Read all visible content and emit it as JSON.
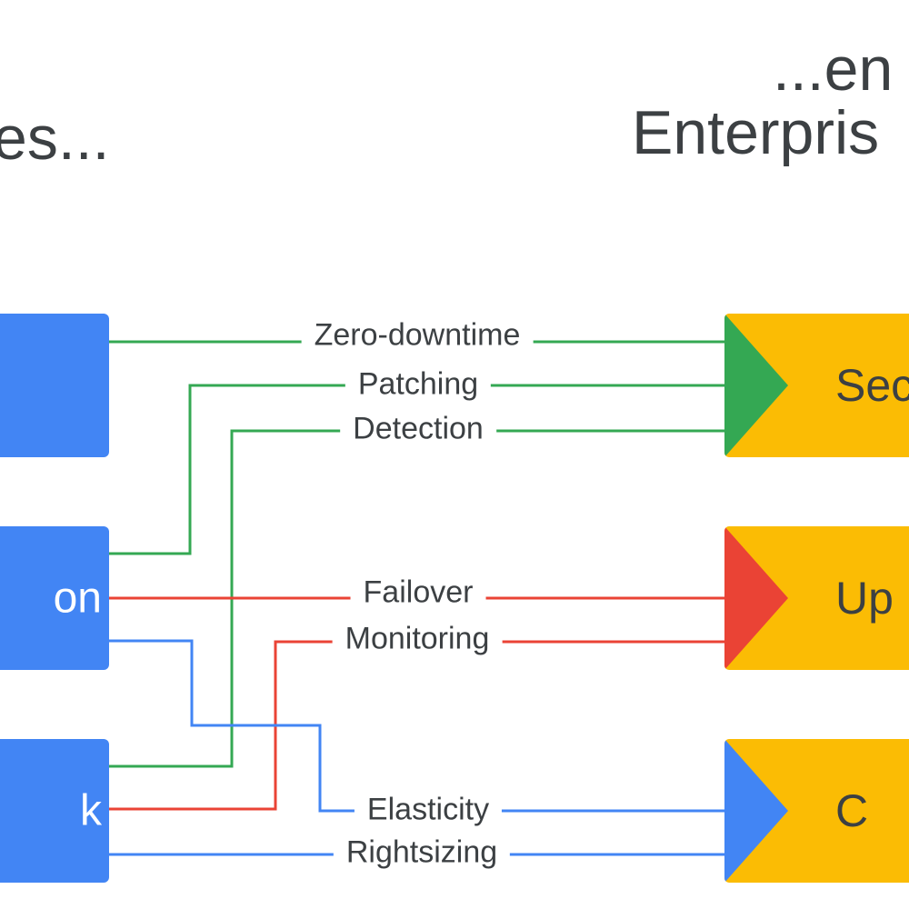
{
  "heading_left": "es...",
  "heading_right_line1": "...en",
  "heading_right_line2": "Enterpris",
  "colors": {
    "blue": "#4285f4",
    "green": "#34a853",
    "red": "#ea4335",
    "yellow": "#fbbc04",
    "text": "#3c4043"
  },
  "sources": [
    {
      "label": ""
    },
    {
      "label": "on"
    },
    {
      "label": "k"
    }
  ],
  "targets": [
    {
      "label": "Sec",
      "accent": "green"
    },
    {
      "label": "Up",
      "accent": "red"
    },
    {
      "label": "C",
      "accent": "blue"
    }
  ],
  "edges": [
    {
      "label": "Zero-downtime",
      "color": "green",
      "from": 0,
      "to": 0
    },
    {
      "label": "Patching",
      "color": "green",
      "from": 1,
      "to": 0
    },
    {
      "label": "Detection",
      "color": "green",
      "from": 2,
      "to": 0
    },
    {
      "label": "Failover",
      "color": "red",
      "from": 1,
      "to": 1
    },
    {
      "label": "Monitoring",
      "color": "red",
      "from": 2,
      "to": 1
    },
    {
      "label": "Elasticity",
      "color": "blue",
      "from": 1,
      "to": 2
    },
    {
      "label": "Rightsizing",
      "color": "blue",
      "from": 2,
      "to": 2
    }
  ]
}
